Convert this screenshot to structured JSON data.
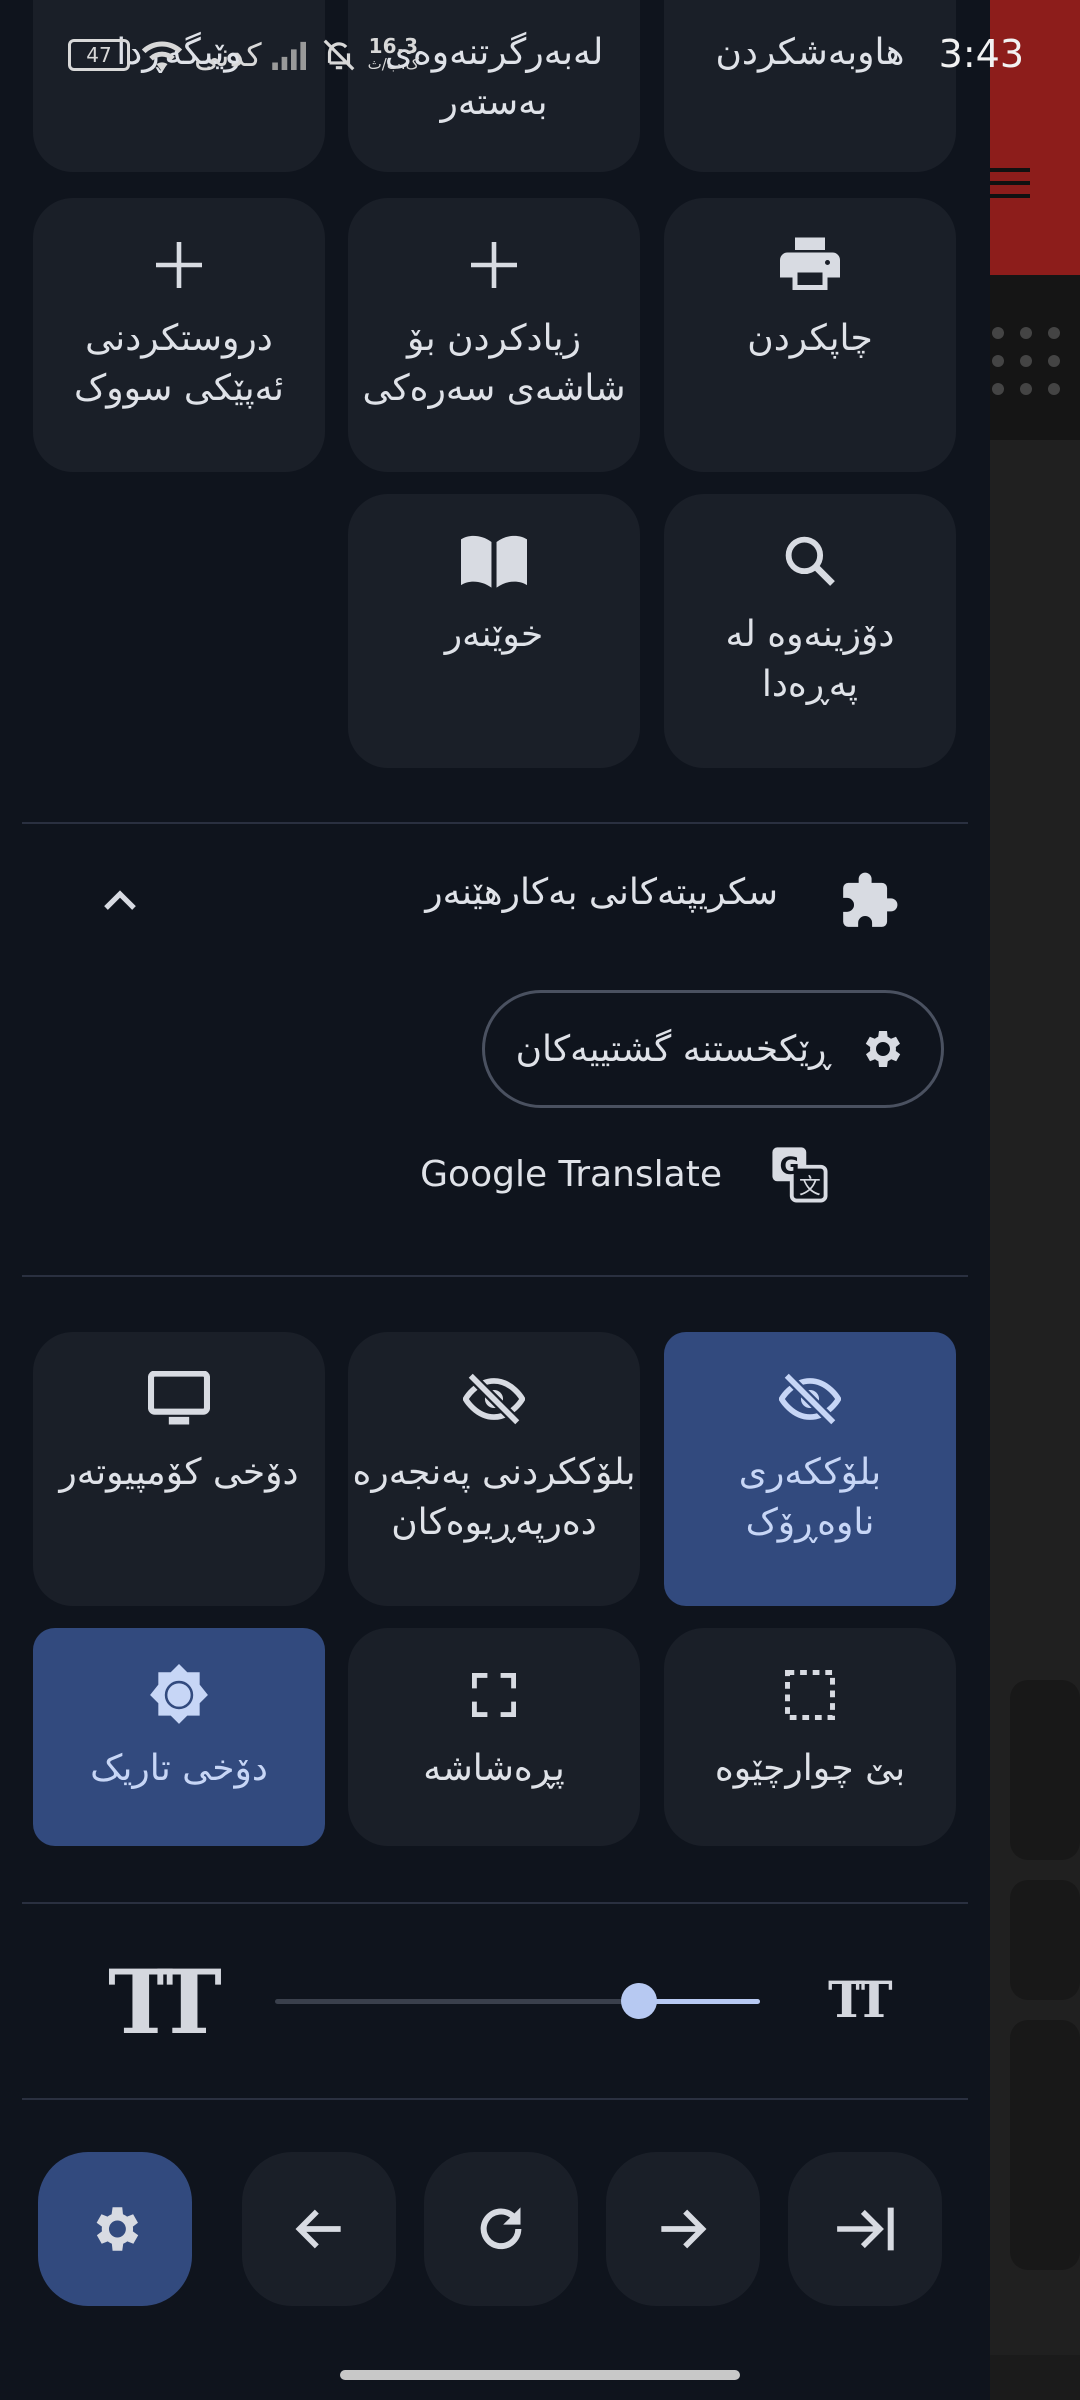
{
  "status_bar": {
    "time": "3:43",
    "battery": "47",
    "carrier": "کدنی",
    "speed": "16.3",
    "speed_unit": "ک.ب/ث"
  },
  "tiles_row0": [
    {
      "label": "هاوبەشکردن",
      "icon": "share-icon"
    },
    {
      "label": "لەبەرگرتنەوەی\nبەستەر",
      "icon": "copy-link-icon"
    },
    {
      "label": "وێبگەڕدا",
      "icon": "browser-icon"
    }
  ],
  "tiles_row1": [
    {
      "label": "چاپکردن",
      "icon": "print-icon"
    },
    {
      "label": "زیادکردن بۆ\nشاشەی سەرەکی",
      "icon": "plus-icon"
    },
    {
      "label": "دروستکردنی\nئەپێکی سووک",
      "icon": "plus-icon"
    }
  ],
  "tiles_row2": [
    {
      "label": "دۆزینەوە لە\nپەڕەدا",
      "icon": "search-icon"
    },
    {
      "label": "خوێنەر",
      "icon": "book-icon"
    }
  ],
  "scripts": {
    "title": "سکریپتەکانی بەکارهێنەر",
    "settings_pill": "ڕێکخستنە گشتییەکان",
    "google_translate": "Google Translate"
  },
  "tiles_row3": [
    {
      "label": "بلۆککەری\nناوەڕۆک",
      "icon": "eye-off-icon",
      "active": true
    },
    {
      "label": "بلۆککردنی پەنجەرە\nدەرپەڕیوەکان",
      "icon": "eye-off-icon",
      "active": false
    },
    {
      "label": "دۆخی کۆمپیوتەر",
      "icon": "monitor-icon",
      "active": false
    }
  ],
  "tiles_row4": [
    {
      "label": "بێ چوارچێوە",
      "icon": "dashed-square-icon",
      "active": false
    },
    {
      "label": "پڕەشاشە",
      "icon": "fullscreen-icon",
      "active": false
    },
    {
      "label": "دۆخی تاریک",
      "icon": "dark-mode-icon",
      "active": true
    }
  ],
  "font_slider": {
    "big_label": "TT",
    "small_label": "TT",
    "level": 0.75
  },
  "colors": {
    "background": "#0f141d",
    "tile": "#1a1f28",
    "active_tile": "#324a7e",
    "accent": "#b7c9f2"
  }
}
